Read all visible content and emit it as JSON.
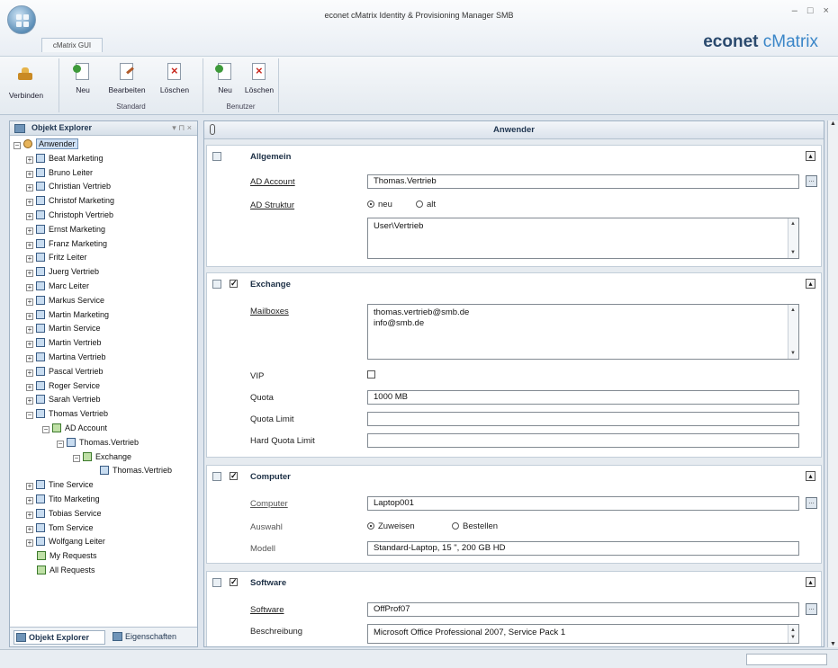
{
  "window": {
    "title": "econet cMatrix Identity & Provisioning Manager SMB",
    "app_tab": "cMatrix GUI",
    "brand_prefix": "econet ",
    "brand_accent": "cMatrix",
    "controls": "– □ ×"
  },
  "ribbon": {
    "connect_label": "Verbinden",
    "standard": {
      "new_label": "Neu",
      "edit_label": "Bearbeiten",
      "delete_label": "Löschen",
      "group_label": "Standard"
    },
    "user": {
      "new_label": "Neu",
      "delete_label": "Löschen",
      "group_label": "Benutzer"
    }
  },
  "explorer": {
    "title": "Objekt Explorer",
    "pins": "▾ ⊓ ×",
    "root": "Anwender",
    "users": [
      "Beat Marketing",
      "Bruno Leiter",
      "Christian Vertrieb",
      "Christof Marketing",
      "Christoph Vertrieb",
      "Ernst Marketing",
      "Franz Marketing",
      "Fritz Leiter",
      "Juerg Vertrieb",
      "Marc Leiter",
      "Markus Service",
      "Martin Marketing",
      "Martin Service",
      "Martin Vertrieb",
      "Martina Vertrieb",
      "Pascal Vertrieb",
      "Roger Service",
      "Sarah Vertrieb",
      "Thomas Vertrieb"
    ],
    "expanded": {
      "ad_account": "AD Account",
      "account_name": "Thomas.Vertrieb",
      "exchange": "Exchange",
      "mailbox_name": "Thomas.Vertrieb"
    },
    "users_after": [
      "Tine Service",
      "Tito Marketing",
      "Tobias Service",
      "Tom Service",
      "Wolfgang Leiter"
    ],
    "requests": [
      "My Requests",
      "All Requests"
    ],
    "tab_explorer": "Objekt Explorer",
    "tab_properties": "Eigenschaften"
  },
  "main": {
    "title": "Anwender",
    "general": {
      "title": "Allgemein",
      "ad_account_label": "AD Account",
      "ad_account_value": "Thomas.Vertrieb",
      "ad_structure_label": "AD Struktur",
      "radio_new": "neu",
      "radio_old": "alt",
      "structure_path": "User\\Vertrieb"
    },
    "exchange": {
      "title": "Exchange",
      "mailboxes_label": "Mailboxes",
      "mailbox_1": "thomas.vertrieb@smb.de",
      "mailbox_2": "info@smb.de",
      "vip_label": "VIP",
      "quota_label": "Quota",
      "quota_value": "1000 MB",
      "quota_limit_label": "Quota Limit",
      "hard_quota_label": "Hard Quota Limit"
    },
    "computer": {
      "title": "Computer",
      "computer_label": "Computer",
      "computer_value": "Laptop001",
      "selection_label": "Auswahl",
      "radio_assign": "Zuweisen",
      "radio_order": "Bestellen",
      "model_label": "Modell",
      "model_value": "Standard-Laptop, 15 \", 200 GB HD"
    },
    "software": {
      "title": "Software",
      "software_label": "Software",
      "software_value": "OffProf07",
      "description_label": "Beschreibung",
      "description_value": "Microsoft Office Professional 2007, Service Pack 1"
    }
  }
}
